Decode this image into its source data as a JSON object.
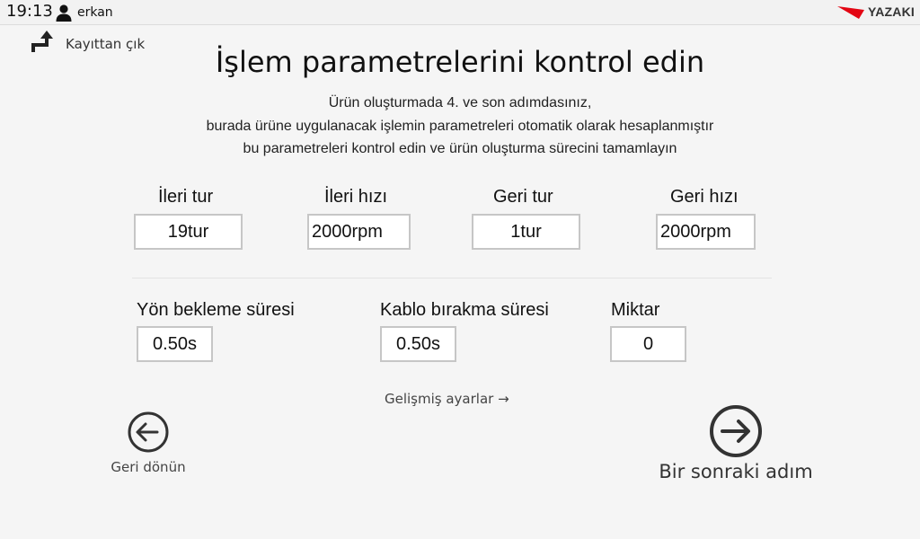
{
  "statusbar": {
    "time": "19:13",
    "user_icon": "user-icon",
    "username": "erkan",
    "brand": "YAZAKI"
  },
  "logout": {
    "icon": "logout-arrow-icon",
    "label": "Kayıttan çık"
  },
  "title": "İşlem parametrelerini kontrol edin",
  "description": {
    "line1": "Ürün oluşturmada 4. ve son adımdasınız,",
    "line2": "burada ürüne uygulanacak işlemin parametreleri otomatik olarak hesaplanmıştır",
    "line3": "bu parametreleri kontrol edin ve ürün oluşturma sürecini tamamlayın"
  },
  "params_row1": {
    "forward_turns": {
      "label": "İleri tur",
      "value": "19tur"
    },
    "forward_speed": {
      "label": "İleri hızı",
      "value": "2000rpm"
    },
    "reverse_turns": {
      "label": "Geri tur",
      "value": "1tur"
    },
    "reverse_speed": {
      "label": "Geri hızı",
      "value": "2000rpm"
    }
  },
  "params_row2": {
    "direction_wait": {
      "label": "Yön bekleme süresi",
      "value": "0.50s"
    },
    "cable_release": {
      "label": "Kablo bırakma süresi",
      "value": "0.50s"
    },
    "quantity": {
      "label": "Miktar",
      "value": "0"
    }
  },
  "advanced_link": "Gelişmiş ayarlar →",
  "back_button": {
    "icon": "arrow-left-circle-icon",
    "label": "Geri dönün"
  },
  "next_button": {
    "icon": "arrow-right-circle-icon",
    "label": "Bir sonraki adım"
  },
  "colors": {
    "brand_red": "#e30613",
    "border": "#c6c6c6",
    "background": "#f5f5f5"
  }
}
